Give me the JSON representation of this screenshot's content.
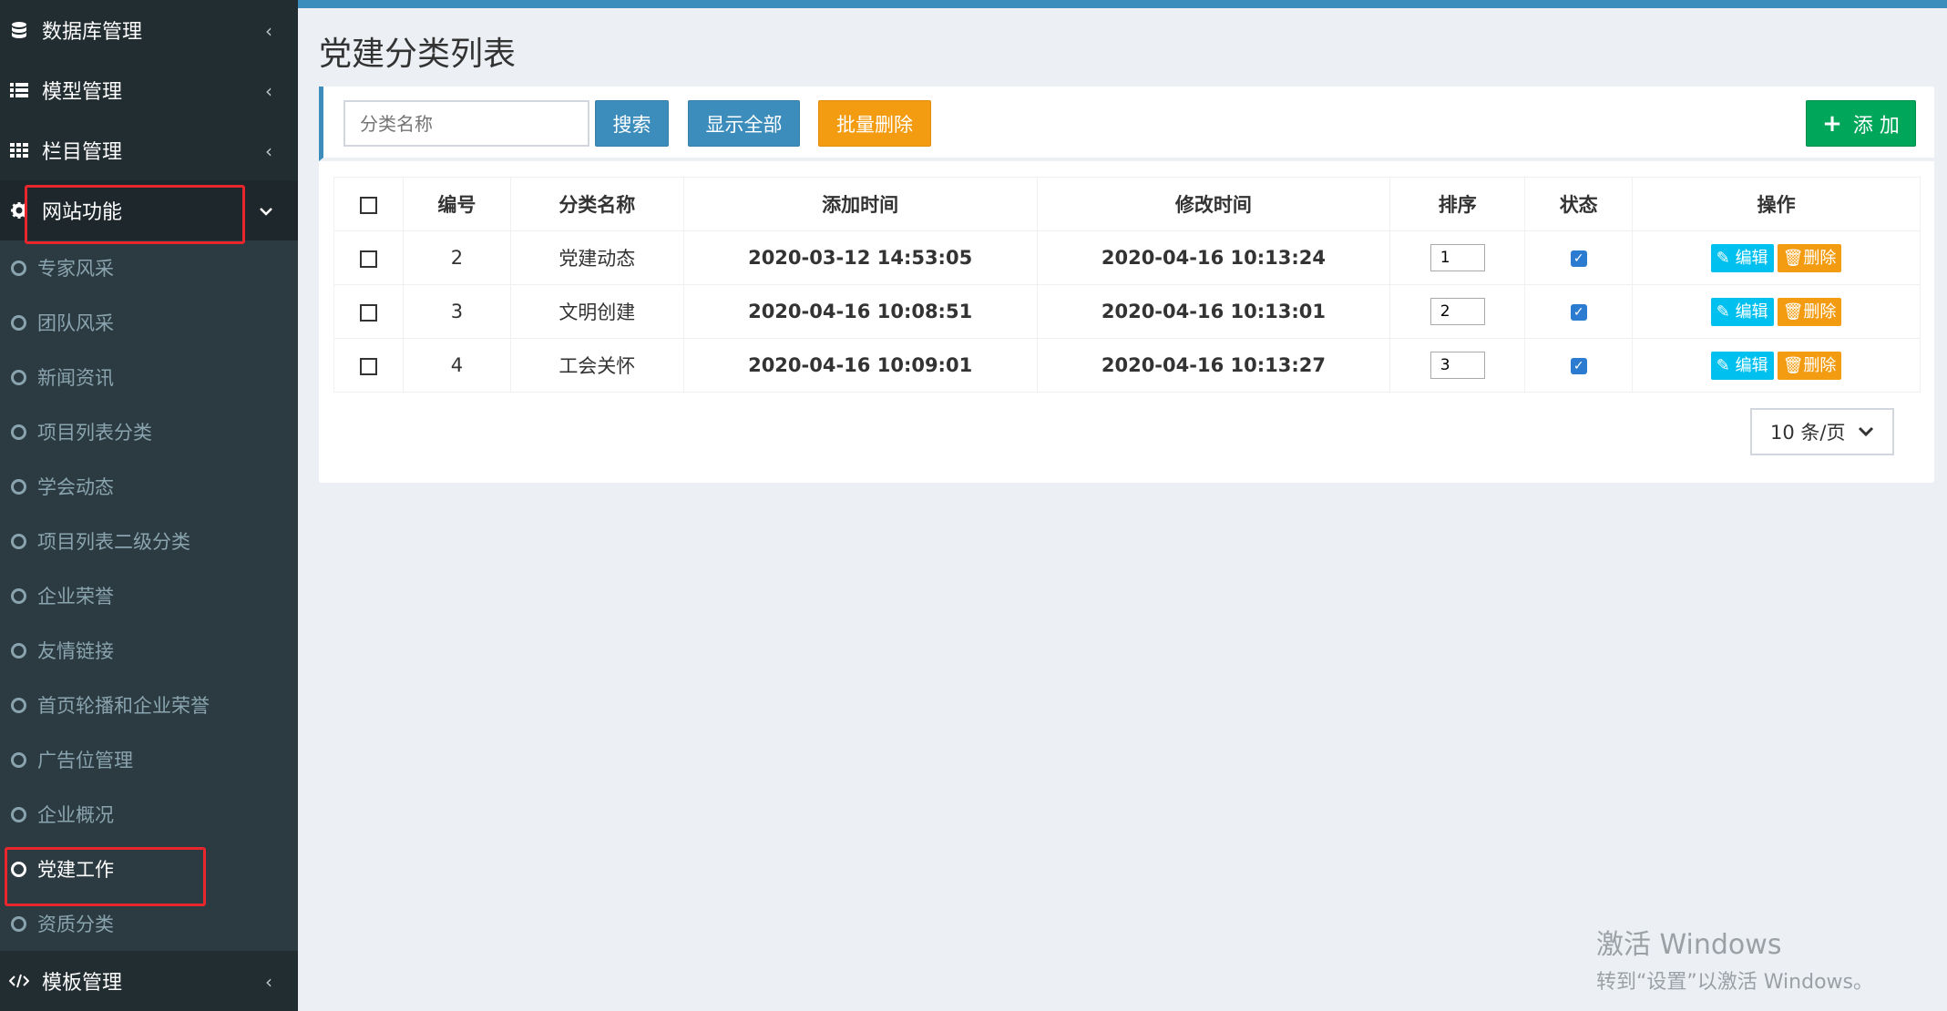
{
  "sidebar": {
    "top_items": [
      {
        "label": "数据库管理",
        "icon": "database-icon"
      },
      {
        "label": "模型管理",
        "icon": "list-icon"
      },
      {
        "label": "栏目管理",
        "icon": "grid-icon"
      }
    ],
    "active_group": {
      "label": "网站功能",
      "icon": "gear-icon"
    },
    "sub_items": [
      "专家风采",
      "团队风采",
      "新闻资讯",
      "项目列表分类",
      "学会动态",
      "项目列表二级分类",
      "企业荣誉",
      "友情链接",
      "首页轮播和企业荣誉",
      "广告位管理",
      "企业概况",
      "党建工作",
      "资质分类"
    ],
    "current_sub_index": 11,
    "bottom_item": {
      "label": "模板管理",
      "icon": "code-icon"
    }
  },
  "page": {
    "title": "党建分类列表"
  },
  "toolbar": {
    "search_placeholder": "分类名称",
    "search_label": "搜索",
    "show_all_label": "显示全部",
    "batch_delete_label": "批量删除",
    "add_label": "添 加"
  },
  "table": {
    "headers": [
      "编号",
      "分类名称",
      "添加时间",
      "修改时间",
      "排序",
      "状态",
      "操作"
    ],
    "rows": [
      {
        "id": "2",
        "name": "党建动态",
        "added": "2020-03-12 14:53:05",
        "modified": "2020-04-16 10:13:24",
        "sort": "1",
        "status": true
      },
      {
        "id": "3",
        "name": "文明创建",
        "added": "2020-04-16 10:08:51",
        "modified": "2020-04-16 10:13:01",
        "sort": "2",
        "status": true
      },
      {
        "id": "4",
        "name": "工会关怀",
        "added": "2020-04-16 10:09:01",
        "modified": "2020-04-16 10:13:27",
        "sort": "3",
        "status": true
      }
    ],
    "edit_label": "编辑",
    "delete_label": "删除"
  },
  "pager": {
    "page_size_label": "10 条/页"
  },
  "watermark": {
    "line1": "激活 Windows",
    "line2": "转到“设置”以激活 Windows。"
  },
  "colors": {
    "sidebar_bg": "#222d32",
    "primary": "#3c8dbc",
    "warning": "#f39c12",
    "success": "#00a65a",
    "info": "#00c0ef",
    "highlight": "#e8262b"
  }
}
